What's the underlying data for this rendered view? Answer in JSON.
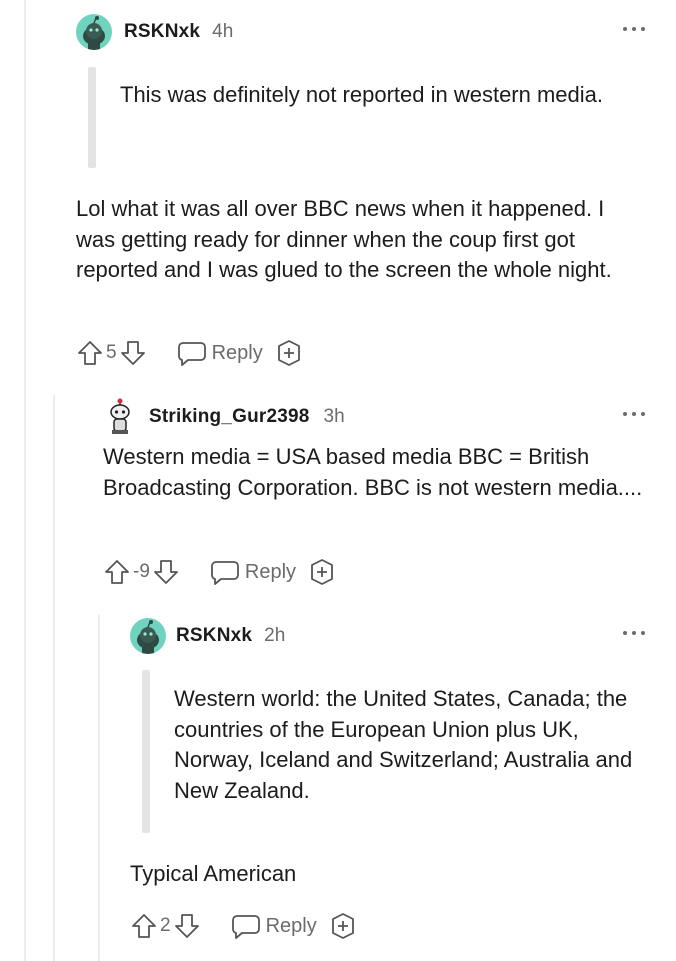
{
  "comments": [
    {
      "username": "RSKNxk",
      "time": "4h",
      "quote": "This was definitely not reported in western media.",
      "body": "Lol what it was all over BBC news when it happened. I was getting ready for dinner when the coup first got reported and I was glued to the screen the whole night.",
      "score": "5",
      "reply_label": "Reply",
      "avatar_color": "#6fd3c0"
    },
    {
      "username": "Striking_Gur2398",
      "time": "3h",
      "body": "Western media = USA based media BBC = British Broadcasting Corporation. BBC is not western media....",
      "score": "-9",
      "reply_label": "Reply",
      "avatar_color": "#ffffff"
    },
    {
      "username": "RSKNxk",
      "time": "2h",
      "quote": "Western world: the United States, Canada; the countries of the European Union plus UK, Norway, Iceland and Switzerland; Australia and New Zealand.",
      "body": "Typical American",
      "score": "2",
      "reply_label": "Reply",
      "avatar_color": "#6fd3c0"
    }
  ],
  "icons": {
    "upvote": "arrow-up-outline-icon",
    "downvote": "arrow-down-outline-icon",
    "reply": "speech-bubble-icon",
    "award": "award-plus-icon",
    "more": "more-dots-icon"
  }
}
